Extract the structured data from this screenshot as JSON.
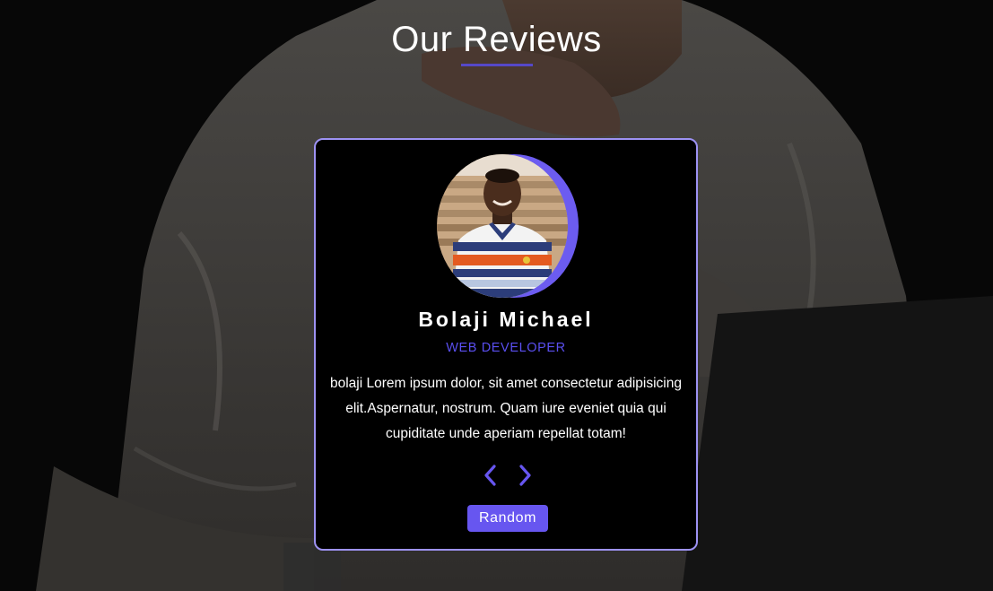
{
  "section": {
    "title": "Our Reviews"
  },
  "review": {
    "author": "Bolaji Michael",
    "job": "web developer",
    "text": "bolaji Lorem ipsum dolor, sit amet consectetur adipisicing elit.Aspernatur, nostrum. Quam iure eveniet quia qui cupiditate unde aperiam repellat totam!"
  },
  "controls": {
    "prev_icon": "chevron-left-icon",
    "next_icon": "chevron-right-icon",
    "random_label": "Random"
  },
  "colors": {
    "accent": "#6756f0",
    "underline": "#5548c8",
    "card_border": "#9d92f3",
    "job_text": "#5a4ff0"
  }
}
